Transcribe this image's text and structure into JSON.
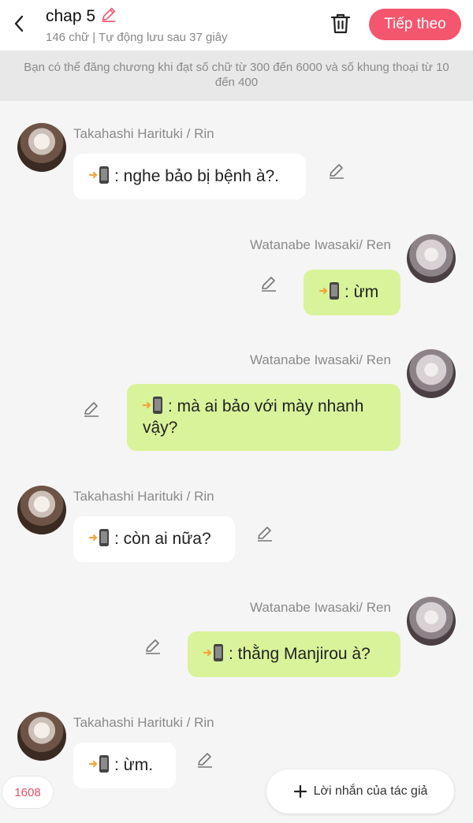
{
  "header": {
    "title": "chap 5",
    "subtitle": "146 chữ | Tự động lưu sau 37 giây",
    "next_label": "Tiếp theo"
  },
  "notice": "Bạn có thể đăng chương khi đạt số chữ từ 300 đến 6000 và số khung thoại từ 10 đến 400",
  "messages": [
    {
      "side": "left",
      "name": "Takahashi Harituki / Rin",
      "text": ": nghe bảo bị bệnh à?."
    },
    {
      "side": "right",
      "name": "Watanabe Iwasaki/ Ren",
      "text": ": ừm"
    },
    {
      "side": "right",
      "name": "Watanabe Iwasaki/ Ren",
      "text": ": mà ai bảo với mày nhanh vậy?"
    },
    {
      "side": "left",
      "name": "Takahashi Harituki / Rin",
      "text": ": còn ai nữa?"
    },
    {
      "side": "right",
      "name": "Watanabe Iwasaki/ Ren",
      "text": ": thằng Manjirou à?"
    },
    {
      "side": "left",
      "name": "Takahashi Harituki / Rin",
      "text": ": ừm."
    }
  ],
  "footer": {
    "count": "1608",
    "author_note_label": "Lời nhắn của tác giả"
  },
  "colors": {
    "accent": "#f4566e",
    "bubble_right": "#d9f39a",
    "bubble_left": "#ffffff"
  },
  "icons": [
    "back-arrow-icon",
    "pencil-icon",
    "trash-icon",
    "phone-icon",
    "plus-icon"
  ]
}
